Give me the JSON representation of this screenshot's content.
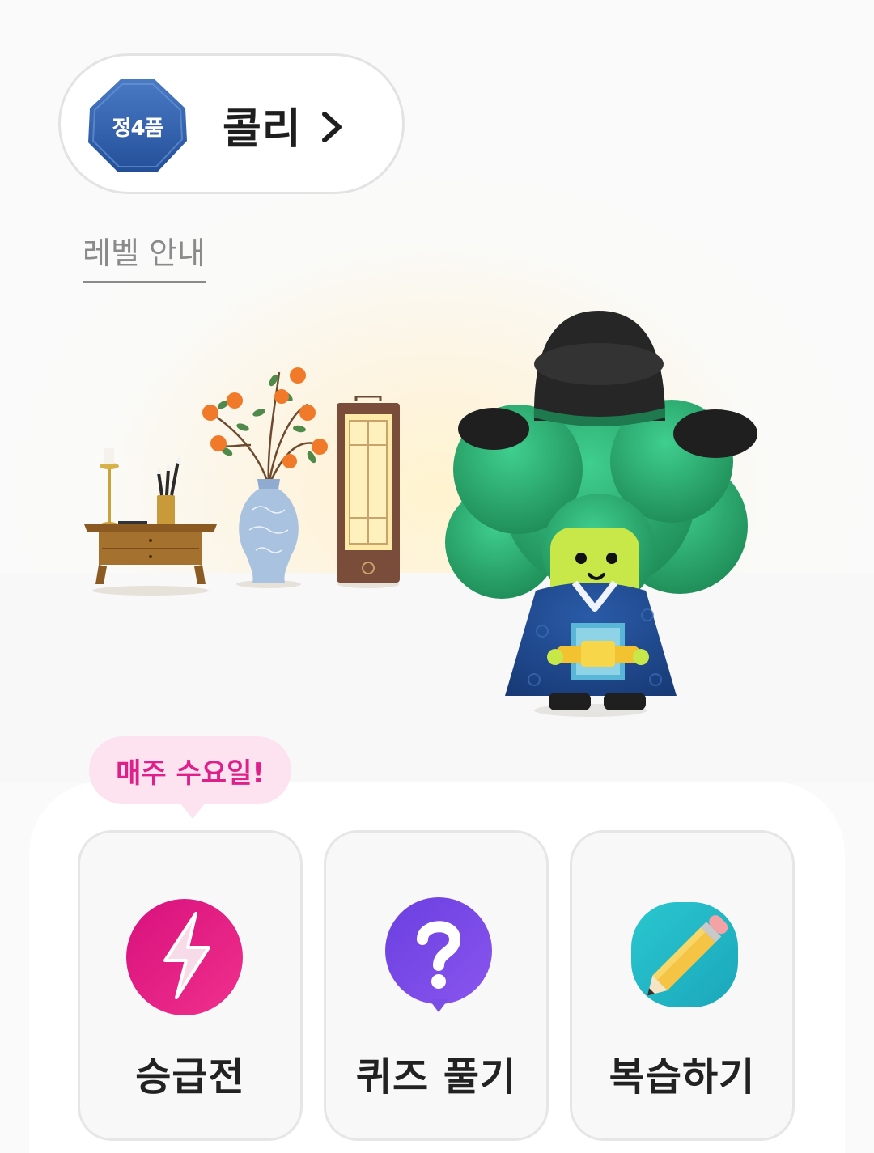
{
  "profile": {
    "rank_badge": "정4품",
    "character_name": "콜리",
    "level_guide_link": "레벨 안내"
  },
  "promo": {
    "tooltip": "매주 수요일!"
  },
  "actions": [
    {
      "label": "승급전",
      "icon": "lightning-icon"
    },
    {
      "label": "퀴즈 풀기",
      "icon": "question-bubble-icon"
    },
    {
      "label": "복습하기",
      "icon": "pencil-icon"
    }
  ],
  "colors": {
    "rank_badge": "#2f5ea8",
    "tooltip_text": "#e0208a",
    "tooltip_bg": "#fde3f0",
    "promotion_icon": "#e5197f",
    "quiz_icon": "#7a4de6",
    "review_icon": "#21b8c4"
  }
}
